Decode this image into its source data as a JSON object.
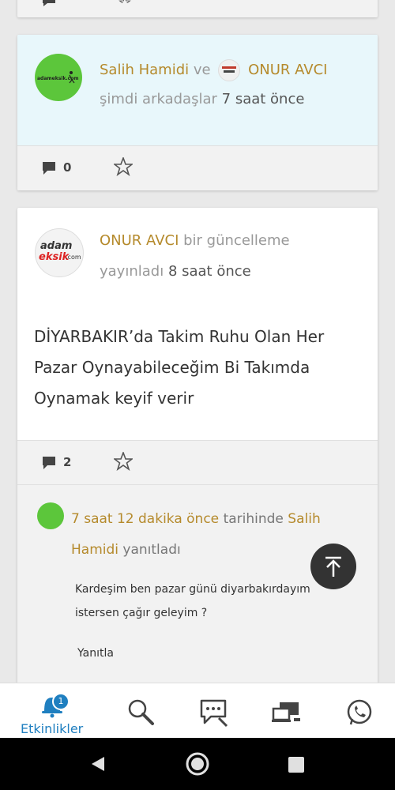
{
  "card1": {
    "user1": "Salih Hamidi",
    "connector": "ve",
    "user2": "ONUR AVCI",
    "status": "şimdi arkadaşlar",
    "time": "7 saat önce",
    "avatar_text": "adameksik.com",
    "comment_count": "0"
  },
  "card2": {
    "user": "ONUR AVCI",
    "action": "bir güncelleme",
    "action2": "yayınladı",
    "time": "8 saat önce",
    "avatar_brand_1": "adam",
    "avatar_brand_2": "eksik",
    "avatar_brand_3": ".com",
    "post_lines": [
      "DİYARBAKIR’da Takim Ruhu Olan Her",
      "Pazar Oynayabileceğim Bi Takımda",
      "Oynamak keyif verir"
    ],
    "comment_count": "2",
    "reply": {
      "time_link": "7 saat 12 dakika önce",
      "tarihinde": "tarihinde",
      "author_a": "Salih",
      "author_b": "Hamidi",
      "verb": "yanıtladı",
      "text_lines": [
        "Kardeşim ben pazar günü diyarbakırdayım",
        "istersen çağır geleyim ?"
      ],
      "reply_button": "Yanıtla"
    }
  },
  "bottom_nav": {
    "active_label": "Etkinlikler",
    "notification_badge": "1",
    "items": [
      "notifications-icon",
      "search-icon",
      "messages-icon",
      "devices-icon",
      "whatsapp-icon"
    ]
  },
  "colors": {
    "link": "#b58a2c",
    "card1_bg": "#e8f7fb",
    "active_nav": "#1f7fc0",
    "fab": "#333333"
  }
}
